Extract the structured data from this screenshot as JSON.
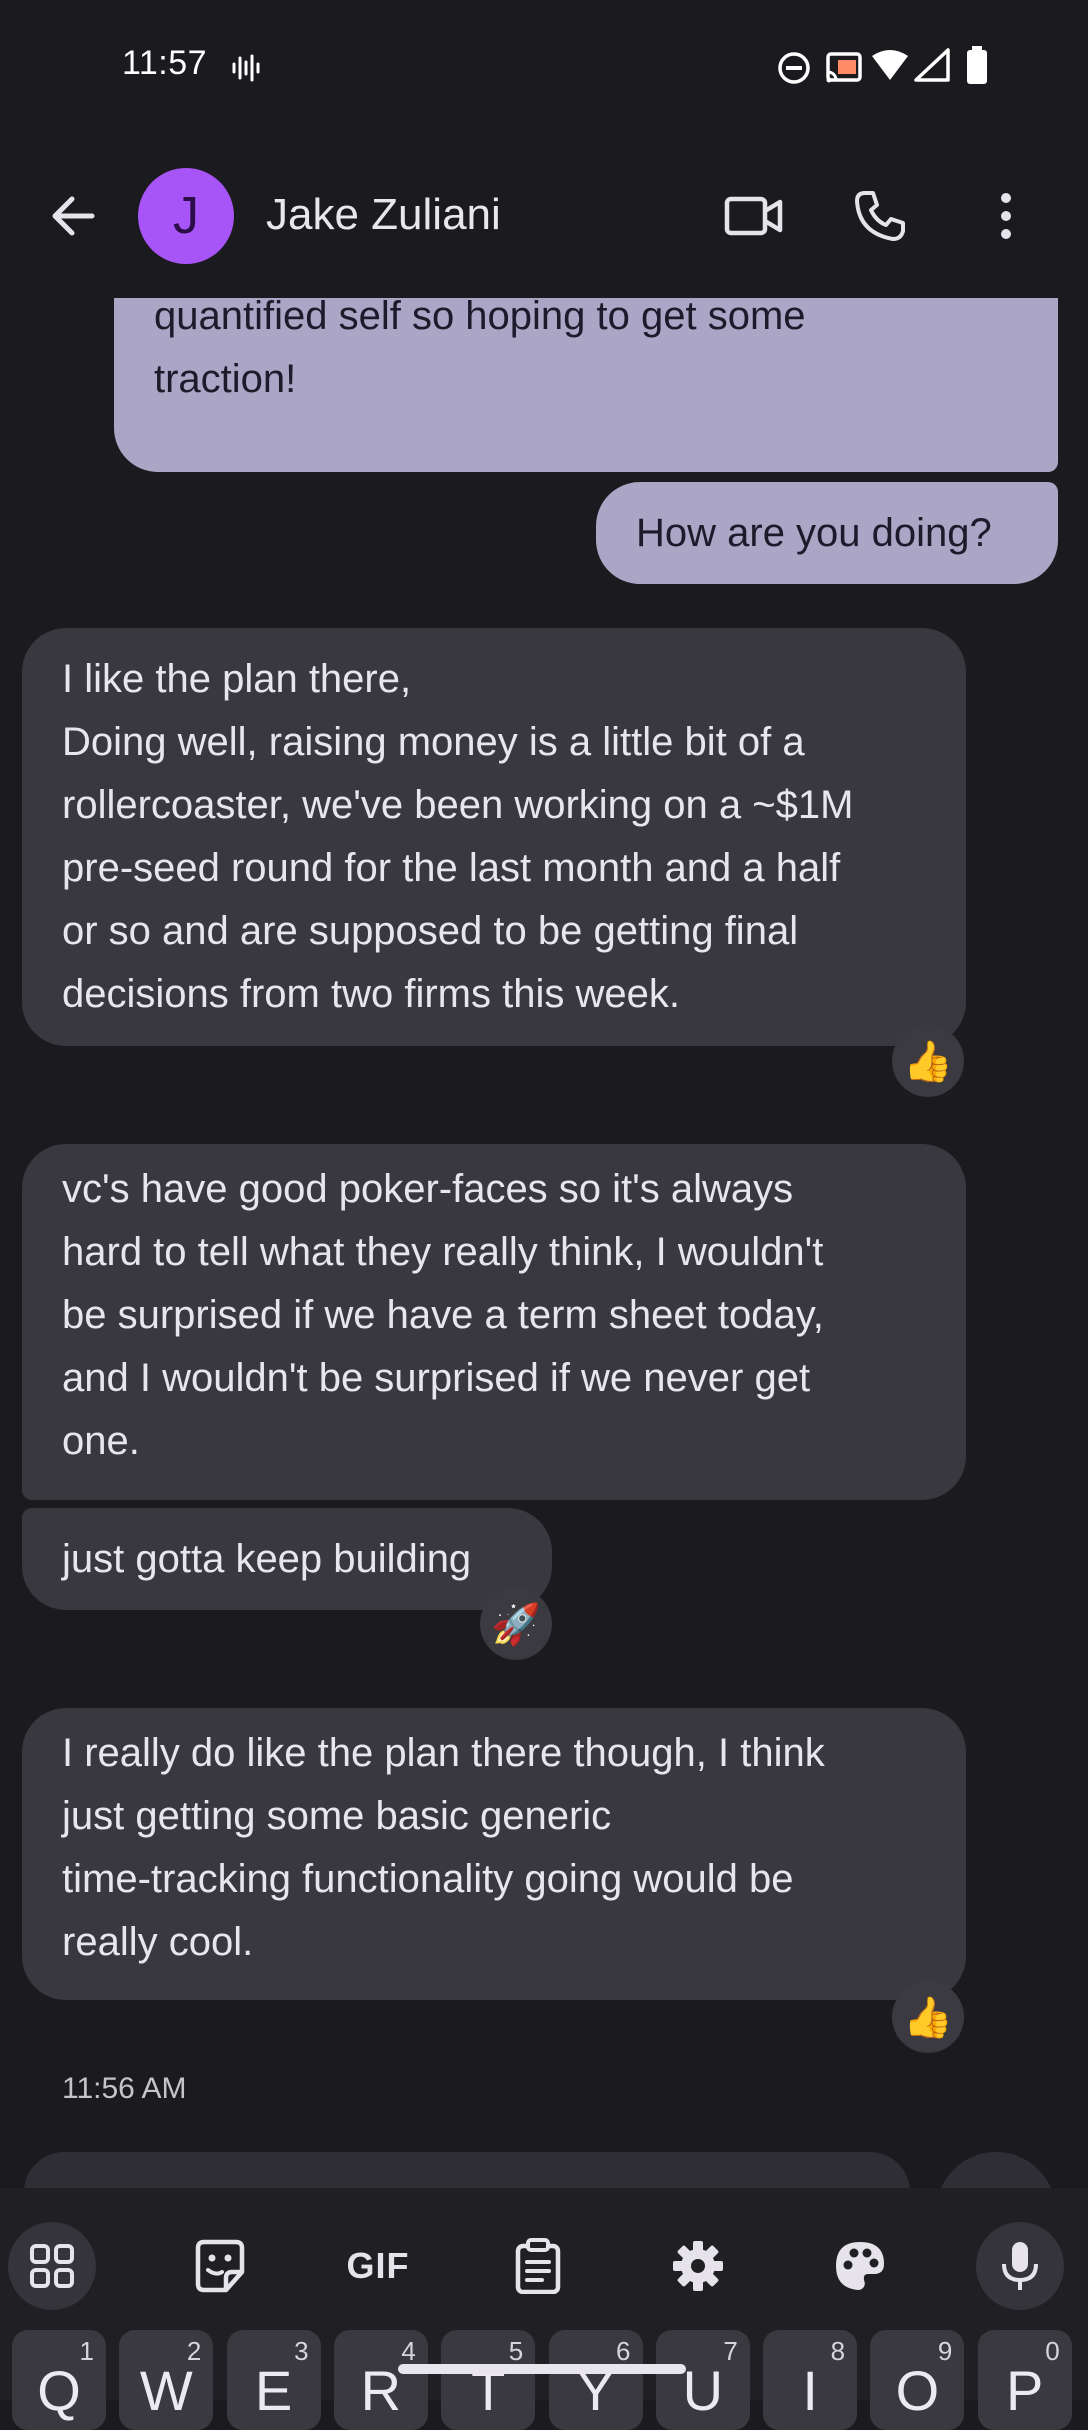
{
  "status_bar": {
    "time": "11:57"
  },
  "header": {
    "avatar_initial": "J",
    "contact_name": "Jake Zuliani"
  },
  "messages": [
    {
      "direction": "out",
      "text": "And also going to post it on Reddit\nquantified self so hoping to get some\ntraction!"
    },
    {
      "direction": "out",
      "text": "How are you doing?"
    },
    {
      "direction": "in",
      "text": "I like the plan there,\nDoing well, raising money is a little bit of a\nrollercoaster, we've been working on a ~$1M\npre-seed round for the last month and a half\nor so and are supposed to be getting final\ndecisions from two firms this week.",
      "reaction": "👍"
    },
    {
      "direction": "in",
      "text": "vc's have good poker-faces so it's always\nhard to tell what they really think, I wouldn't\nbe surprised if we have a term sheet today,\nand I wouldn't be surprised if we never get\none."
    },
    {
      "direction": "in",
      "text": "just gotta keep building",
      "reaction": "🚀"
    },
    {
      "direction": "in",
      "text": "I really do like the plan there though, I think\njust getting some basic generic\ntime-tracking functionality going would be\nreally cool.",
      "reaction": "👍"
    }
  ],
  "timestamp": "11:56 AM",
  "keyboard": {
    "gif_label": "GIF",
    "keys": [
      {
        "ch": "Q",
        "num": "1"
      },
      {
        "ch": "W",
        "num": "2"
      },
      {
        "ch": "E",
        "num": "3"
      },
      {
        "ch": "R",
        "num": "4"
      },
      {
        "ch": "T",
        "num": "5"
      },
      {
        "ch": "Y",
        "num": "6"
      },
      {
        "ch": "U",
        "num": "7"
      },
      {
        "ch": "I",
        "num": "8"
      },
      {
        "ch": "O",
        "num": "9"
      },
      {
        "ch": "P",
        "num": "0"
      }
    ]
  },
  "colors": {
    "background": "#1b1b1f",
    "outgoing_bubble": "#aba6c5",
    "incoming_bubble": "#39383e",
    "avatar": "#a855f7"
  },
  "icons": [
    "voice-activity-icon",
    "do-not-disturb-icon",
    "cast-icon",
    "wifi-icon",
    "signal-icon",
    "battery-icon",
    "back-arrow-icon",
    "video-call-icon",
    "phone-icon",
    "more-options-icon",
    "apps-grid-icon",
    "sticker-icon",
    "clipboard-icon",
    "settings-icon",
    "palette-icon",
    "microphone-icon"
  ]
}
